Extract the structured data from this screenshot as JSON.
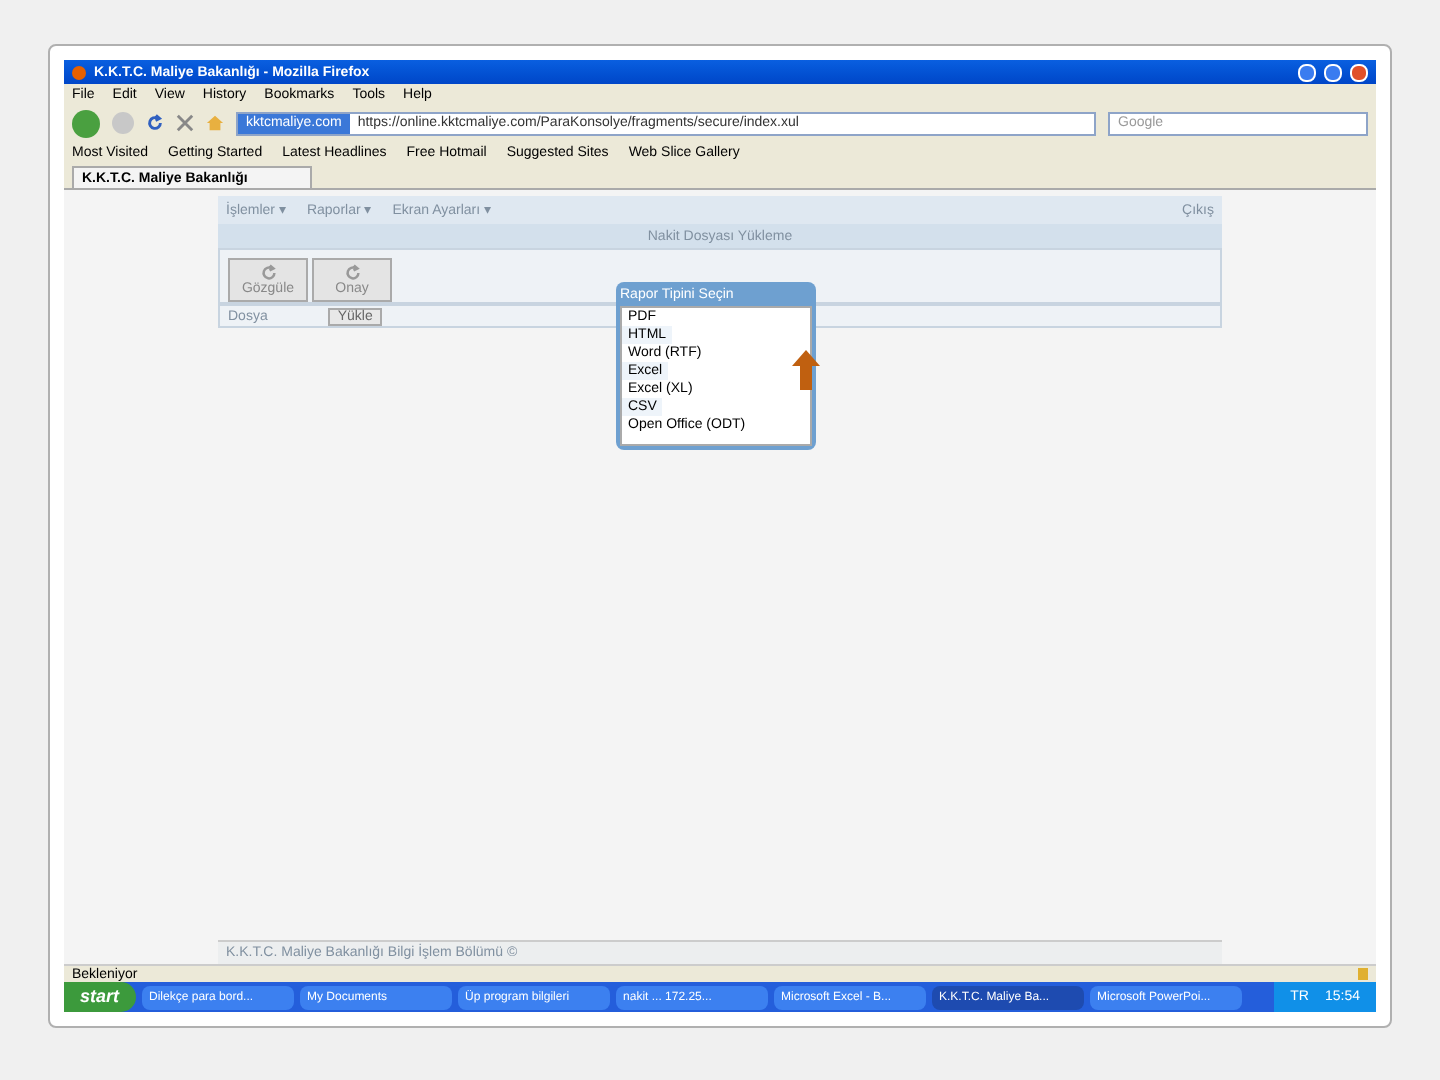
{
  "window": {
    "title": "K.K.T.C. Maliye Bakanlığı - Mozilla Firefox"
  },
  "menu": [
    "File",
    "Edit",
    "View",
    "History",
    "Bookmarks",
    "Tools",
    "Help"
  ],
  "nav": {
    "site": "kktcmaliye.com",
    "url": "https://online.kktcmaliye.com/ParaKonsolye/fragments/secure/index.xul",
    "search_placeholder": "Google"
  },
  "bookmarks": [
    "Most Visited",
    "Getting Started",
    "Latest Headlines",
    "Free Hotmail",
    "Suggested Sites",
    "Web Slice Gallery"
  ],
  "tabs": [
    {
      "label": "K.K.T.C. Maliye Bakanlığı",
      "selected": true
    }
  ],
  "app": {
    "menus": [
      "İşlemler ▾",
      "Raporlar ▾",
      "Ekran Ayarları ▾"
    ],
    "exit": "Çıkış",
    "header": "Nakit Dosyası Yükleme",
    "tools": [
      "Gözgüle",
      "Onay"
    ],
    "field_label": "Dosya",
    "upload": "Yükle",
    "footer": "K.K.T.C. Maliye Bakanlığı Bilgi İşlem Bölümü ©"
  },
  "dialog": {
    "title": "Rapor Tipini Seçin",
    "items": [
      {
        "label": "PDF",
        "selected": false
      },
      {
        "label": "HTML",
        "selected": false
      },
      {
        "label": "Word (RTF)",
        "selected": false
      },
      {
        "label": "Excel",
        "selected": false
      },
      {
        "label": "Excel (XL)",
        "selected": false
      },
      {
        "label": "CSV",
        "selected": false
      },
      {
        "label": "Open Office (ODT)",
        "selected": false
      }
    ]
  },
  "status": "Bekleniyor",
  "taskbar": {
    "start": "start",
    "items": [
      {
        "label": "Dilekçe para bord...",
        "active": false
      },
      {
        "label": "My Documents",
        "active": false
      },
      {
        "label": "Üp program bilgileri",
        "active": false
      },
      {
        "label": "nakit ... 172.25...",
        "active": false
      },
      {
        "label": "Microsoft Excel - B...",
        "active": false
      },
      {
        "label": "K.K.T.C. Maliye Ba...",
        "active": true
      },
      {
        "label": "Microsoft PowerPoi...",
        "active": false
      }
    ],
    "lang": "TR",
    "clock": "15:54"
  }
}
